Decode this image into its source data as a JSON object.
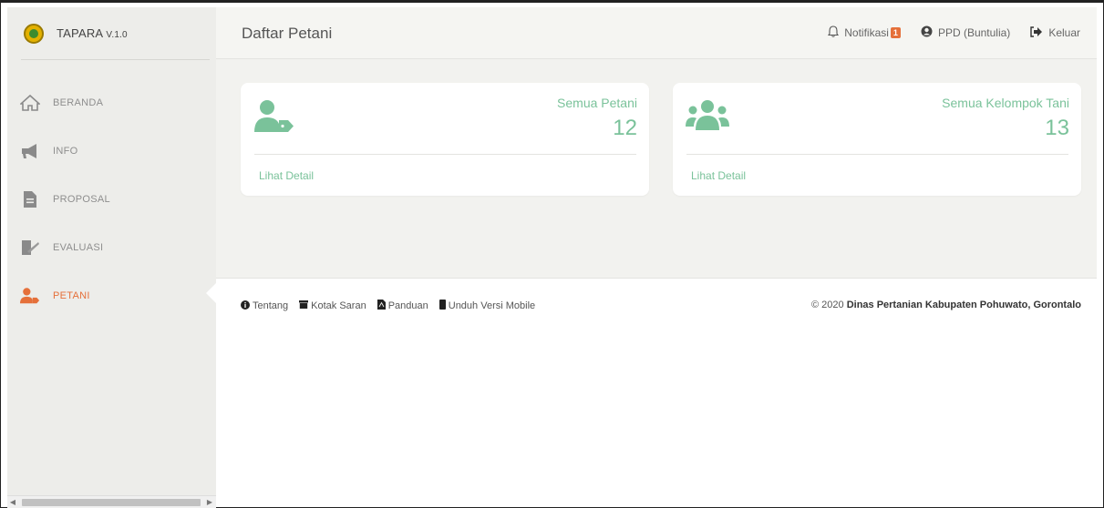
{
  "brand": {
    "name": "TAPARA",
    "version": "V.1.0"
  },
  "sidebar": {
    "items": [
      {
        "label": "BERANDA",
        "icon": "home-icon"
      },
      {
        "label": "INFO",
        "icon": "megaphone-icon"
      },
      {
        "label": "PROPOSAL",
        "icon": "file-icon"
      },
      {
        "label": "EVALUASI",
        "icon": "evaluation-icon"
      },
      {
        "label": "PETANI",
        "icon": "farmer-icon",
        "active": true
      }
    ]
  },
  "header": {
    "title": "Daftar Petani",
    "notifications_label": "Notifikasi",
    "notifications_count": "1",
    "user_label": "PPD (Buntulia)",
    "logout_label": "Keluar"
  },
  "cards": [
    {
      "title": "Semua Petani",
      "value": "12",
      "link": "Lihat Detail",
      "icon": "farmer-tag-icon"
    },
    {
      "title": "Semua Kelompok Tani",
      "value": "13",
      "link": "Lihat Detail",
      "icon": "users-group-icon"
    }
  ],
  "footer": {
    "links": [
      "Tentang",
      "Kotak Saran",
      "Panduan",
      "Unduh Versi Mobile"
    ],
    "copyright_prefix": "© 2020",
    "copyright_org": "Dinas Pertanian Kabupaten Pohuwato, Gorontalo"
  },
  "colors": {
    "accent": "#7ac29a",
    "active": "#e5703a",
    "sidebar_bg": "#ededea"
  }
}
